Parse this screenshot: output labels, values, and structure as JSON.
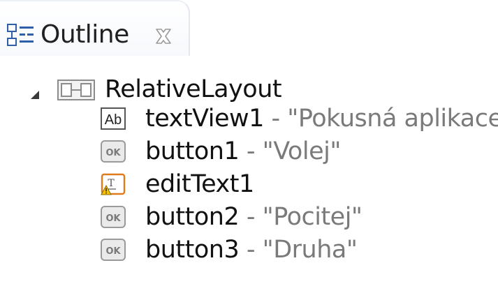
{
  "view": {
    "title": "Outline",
    "tab_icon": "outline-view-icon",
    "close_icon": "close-icon"
  },
  "tree": {
    "root": {
      "label": "RelativeLayout",
      "icon": "relative-layout-icon",
      "expanded": true
    },
    "children": [
      {
        "id": "textView1",
        "separator": " - ",
        "text": "\"Pokusná aplikace\"",
        "icon": "textview-ab-icon"
      },
      {
        "id": "button1",
        "separator": " - ",
        "text": "\"Volej\"",
        "icon": "button-ok-icon"
      },
      {
        "id": "editText1",
        "separator": "",
        "text": "",
        "icon": "edittext-warning-icon"
      },
      {
        "id": "button2",
        "separator": " - ",
        "text": "\"Pocitej\"",
        "icon": "button-ok-icon"
      },
      {
        "id": "button3",
        "separator": " - ",
        "text": "\"Druha\"",
        "icon": "button-ok-icon"
      }
    ]
  },
  "colors": {
    "tab_border": "#e3e8ef",
    "icon_blue": "#2f5fa8",
    "warning_orange": "#e07a1f",
    "secondary_text": "#7a7a7a"
  }
}
